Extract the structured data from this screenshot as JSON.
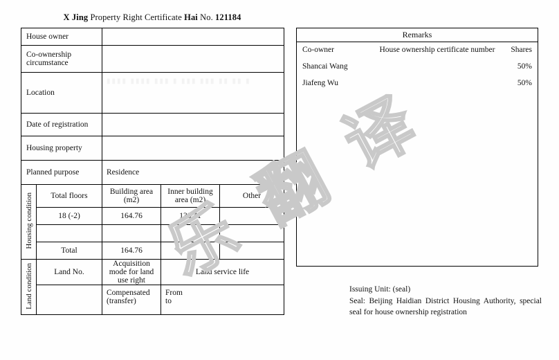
{
  "document": {
    "title_parts": {
      "b1": "X Jing",
      "n1": " Property Right Certificate ",
      "b2": "Hai",
      "n2": " No. ",
      "b3": "121184"
    },
    "title_full": "X Jing Property Right Certificate Hai No. 121184"
  },
  "watermark": {
    "text": "乐翻译",
    "chars": [
      "乐",
      "翻",
      "译"
    ],
    "color": "#c9c9c9"
  },
  "main_table": {
    "rows": [
      {
        "label": "House owner",
        "value": ""
      },
      {
        "label": "Co-ownership circumstance",
        "value": ""
      },
      {
        "label": "Location",
        "value": ""
      },
      {
        "label": "Date of registration",
        "value": ""
      },
      {
        "label": "Housing property",
        "value": ""
      },
      {
        "label": "Planned purpose",
        "value": "Residence"
      }
    ],
    "location_redacted": "▮▮▮▮ ▮▮▮▮ ▮▮▮   ▮ ▮▮▮   ▮▮▮ ▮▮ ▮▮ ▮"
  },
  "housing_condition": {
    "side_label": "Housing condition",
    "headers": [
      "Total floors",
      "Building area (m2)",
      "Inner building area (m2)",
      "Other"
    ],
    "rows": [
      [
        "18 (-2)",
        "164.76",
        "138.41",
        ""
      ],
      [
        "",
        "",
        "",
        ""
      ],
      [
        "Total",
        "164.76",
        "",
        ""
      ]
    ]
  },
  "land_condition": {
    "side_label": "Land condition",
    "headers": [
      "Land No.",
      "Acquisition mode for land use right",
      "Land service life"
    ],
    "row": {
      "land_no": "",
      "acquisition_mode_line1": "Compensated",
      "acquisition_mode_line2": "(transfer)",
      "service_life_line1": "From",
      "service_life_line2": "to"
    }
  },
  "remarks": {
    "title": "Remarks",
    "headers": {
      "co_owner": "Co-owner",
      "certificate_number": "House ownership certificate number",
      "shares": "Shares"
    },
    "rows": [
      {
        "co_owner": "Shancai Wang",
        "certificate_number": "",
        "shares": "50%"
      },
      {
        "co_owner": "Jiafeng Wu",
        "certificate_number": "",
        "shares": "50%"
      }
    ]
  },
  "issuing": {
    "line1": "Issuing Unit: (seal)",
    "line2": "Seal: Beijing Haidian District Housing Authority, special seal for house ownership registration"
  }
}
